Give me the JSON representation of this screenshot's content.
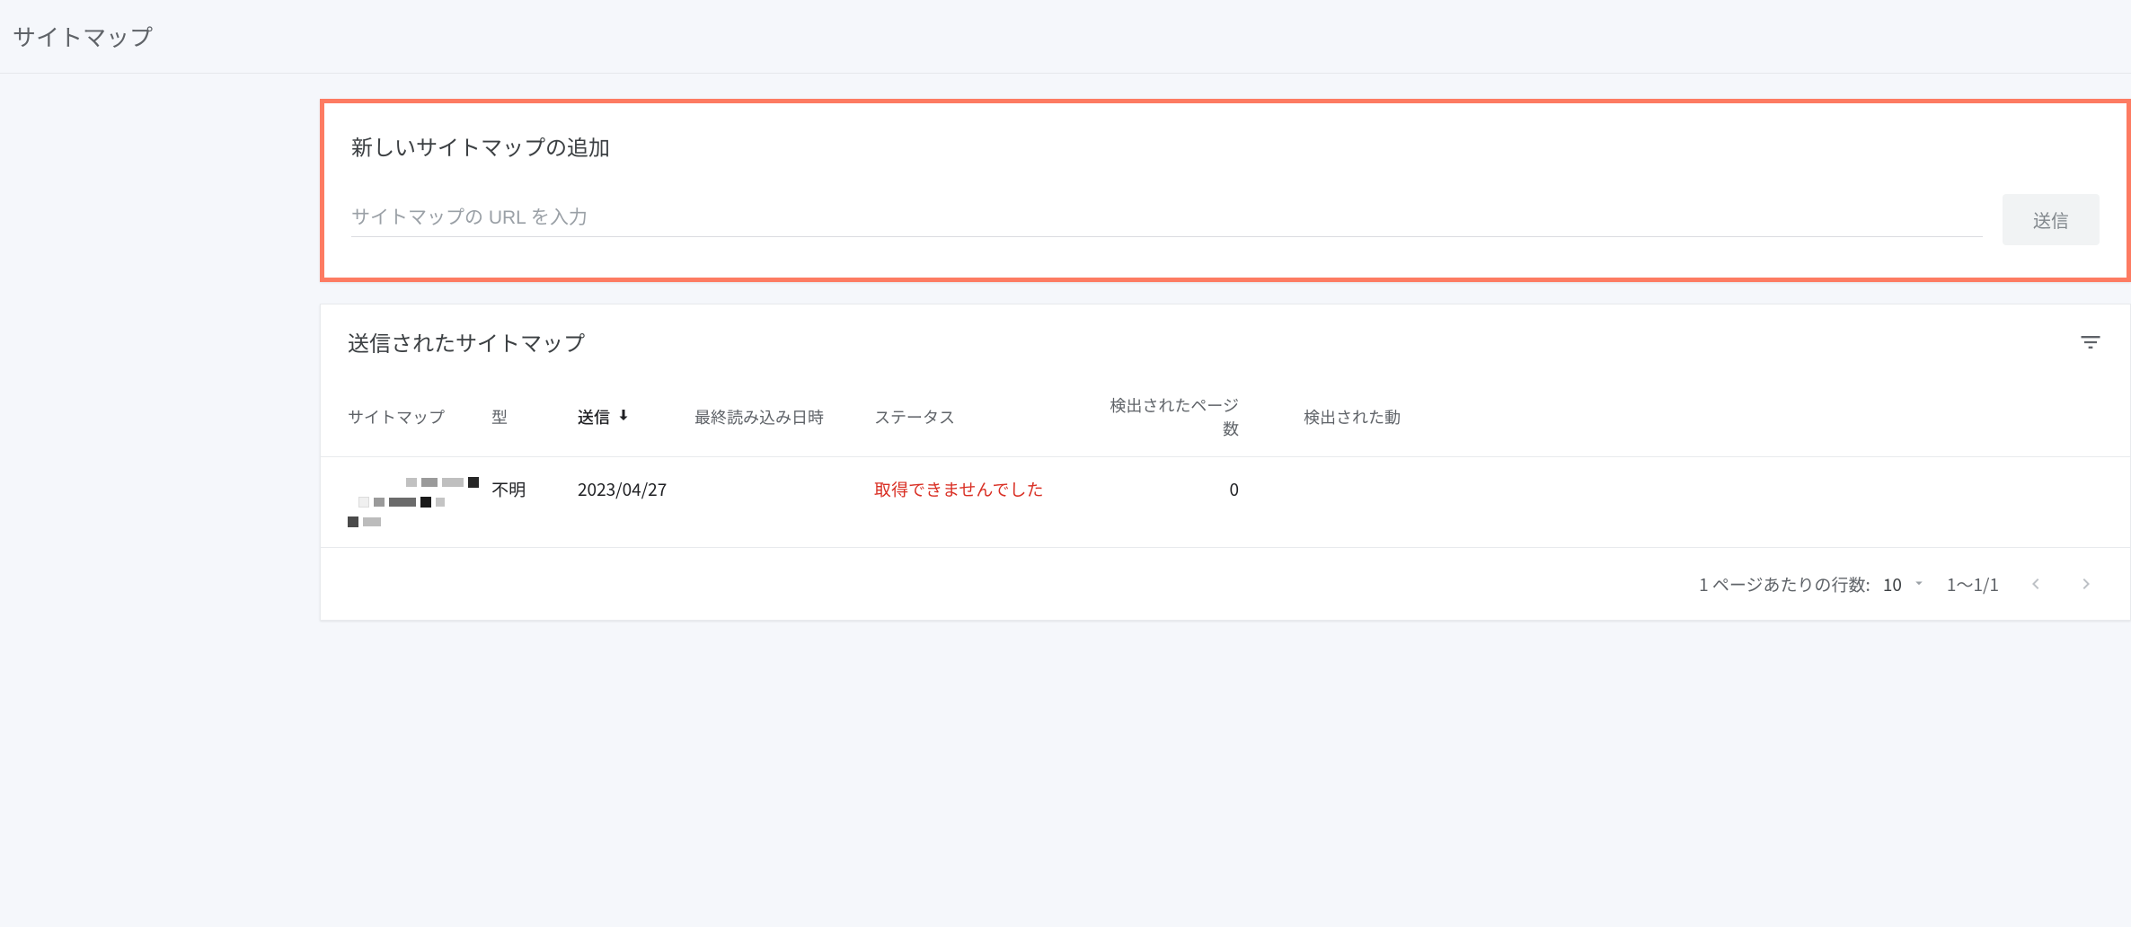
{
  "header": {
    "title": "サイトマップ"
  },
  "add_card": {
    "title": "新しいサイトマップの追加",
    "input_placeholder": "サイトマップの URL を入力",
    "submit_label": "送信"
  },
  "list_card": {
    "title": "送信されたサイトマップ",
    "columns": {
      "sitemap": "サイトマップ",
      "type": "型",
      "sent": "送信",
      "last_read": "最終読み込み日時",
      "status": "ステータス",
      "pages": "検出されたページ数",
      "videos": "検出された動"
    },
    "rows": [
      {
        "type": "不明",
        "sent": "2023/04/27",
        "last_read": "",
        "status": "取得できませんでした",
        "pages": "0"
      }
    ],
    "pagination": {
      "rows_label": "1 ページあたりの行数:",
      "rows_value": "10",
      "range": "1～1/1"
    }
  }
}
